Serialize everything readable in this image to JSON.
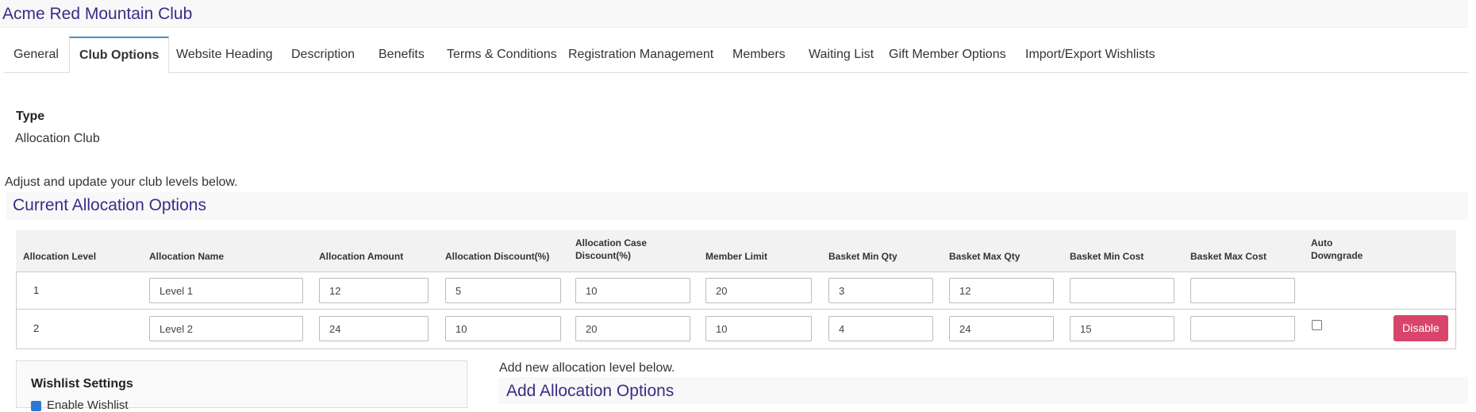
{
  "app": {
    "title": "Acme Red Mountain Club"
  },
  "tabs": [
    {
      "label": "General"
    },
    {
      "label": "Club Options"
    },
    {
      "label": "Website Heading"
    },
    {
      "label": "Description"
    },
    {
      "label": "Benefits"
    },
    {
      "label": "Terms & Conditions"
    },
    {
      "label": "Registration Management"
    },
    {
      "label": "Members"
    },
    {
      "label": "Waiting List"
    },
    {
      "label": "Gift Member Options"
    },
    {
      "label": "Import/Export Wishlists"
    }
  ],
  "active_tab": "Club Options",
  "type": {
    "label": "Type",
    "value": "Allocation Club"
  },
  "intro_text": "Adjust and update your club levels below.",
  "current_section": {
    "title": "Current Allocation Options"
  },
  "table": {
    "headers": {
      "level": "Allocation Level",
      "name": "Allocation Name",
      "amount": "Allocation Amount",
      "discount": "Allocation Discount(%)",
      "case_discount_1": "Allocation Case",
      "case_discount_2": "Discount(%)",
      "member_limit": "Member Limit",
      "basket_min_qty": "Basket Min Qty",
      "basket_max_qty": "Basket Max Qty",
      "basket_min_cost": "Basket Min Cost",
      "basket_max_cost": "Basket Max Cost",
      "auto_downgrade_1": "Auto",
      "auto_downgrade_2": "Downgrade"
    },
    "rows": [
      {
        "level": "1",
        "name": "Level 1",
        "amount": "12",
        "discount": "5",
        "case_discount": "10",
        "member_limit": "20",
        "basket_min_qty": "3",
        "basket_max_qty": "12",
        "basket_min_cost": "",
        "basket_max_cost": ""
      },
      {
        "level": "2",
        "name": "Level 2",
        "amount": "24",
        "discount": "10",
        "case_discount": "20",
        "member_limit": "10",
        "basket_min_qty": "4",
        "basket_max_qty": "24",
        "basket_min_cost": "15",
        "basket_max_cost": "",
        "action_label": "Disable"
      }
    ]
  },
  "wishlist": {
    "title": "Wishlist Settings",
    "enable_label": "Enable Wishlist"
  },
  "add_section": {
    "intro": "Add new allocation level below.",
    "title": "Add Allocation Options"
  },
  "colors": {
    "heading": "#3e2a87",
    "danger": "#d9456a",
    "tab_accent": "#4a90c8"
  }
}
